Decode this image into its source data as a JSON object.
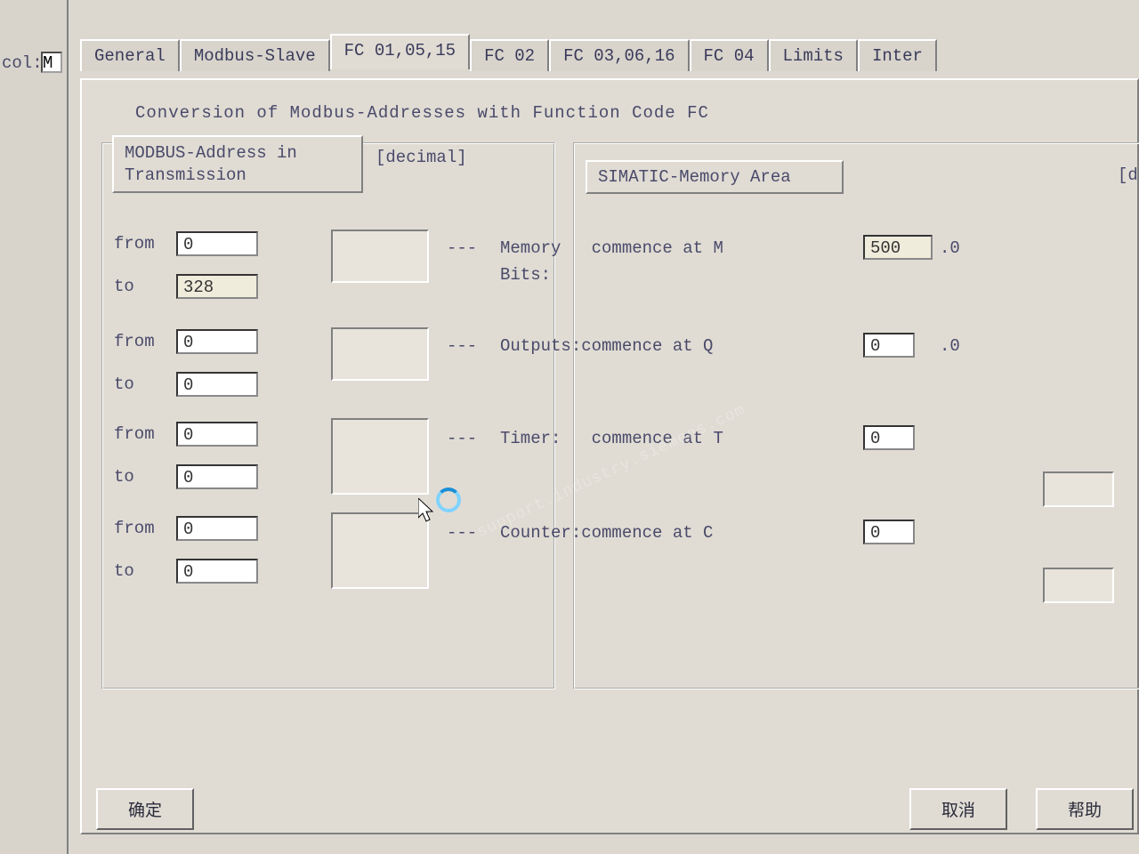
{
  "outer": {
    "col_label": "col:",
    "col_value": "M"
  },
  "tabs": [
    {
      "label": "General"
    },
    {
      "label": "Modbus-Slave"
    },
    {
      "label": "FC 01,05,15"
    },
    {
      "label": "FC 02"
    },
    {
      "label": "FC 03,06,16"
    },
    {
      "label": "FC 04"
    },
    {
      "label": "Limits"
    },
    {
      "label": "Inter"
    }
  ],
  "active_tab": 2,
  "panel": {
    "title": "Conversion of  Modbus-Addresses  with  Function Code  FC",
    "left_legend_line1": "MODBUS-Address in",
    "left_legend_line2": "Transmission",
    "decimal": "[decimal]",
    "right_legend": "SIMATIC-Memory Area",
    "decimal2": "[decimal"
  },
  "rows": [
    {
      "from": "0",
      "to": "328"
    },
    {
      "from": "0",
      "to": "0"
    },
    {
      "from": "0",
      "to": "0"
    },
    {
      "from": "0",
      "to": "0"
    }
  ],
  "labels": {
    "from": "from",
    "to": "to",
    "dashes": "---"
  },
  "right_rows": [
    {
      "text": "Memory   commence at M",
      "value": "500",
      "suffix": ".0",
      "field_class": "shade"
    },
    {
      "text2": "Bits:"
    },
    {
      "text": "Outputs:commence at Q",
      "value": "0",
      "suffix": ".0"
    },
    {
      "text": "Timer:   commence at T",
      "value": "0"
    },
    {
      "text": "Counter:commence at C",
      "value": "0"
    }
  ],
  "buttons": {
    "ok": "确定",
    "cancel": "取消",
    "help": "帮助"
  },
  "watermark": "support.industry.siemens.com"
}
